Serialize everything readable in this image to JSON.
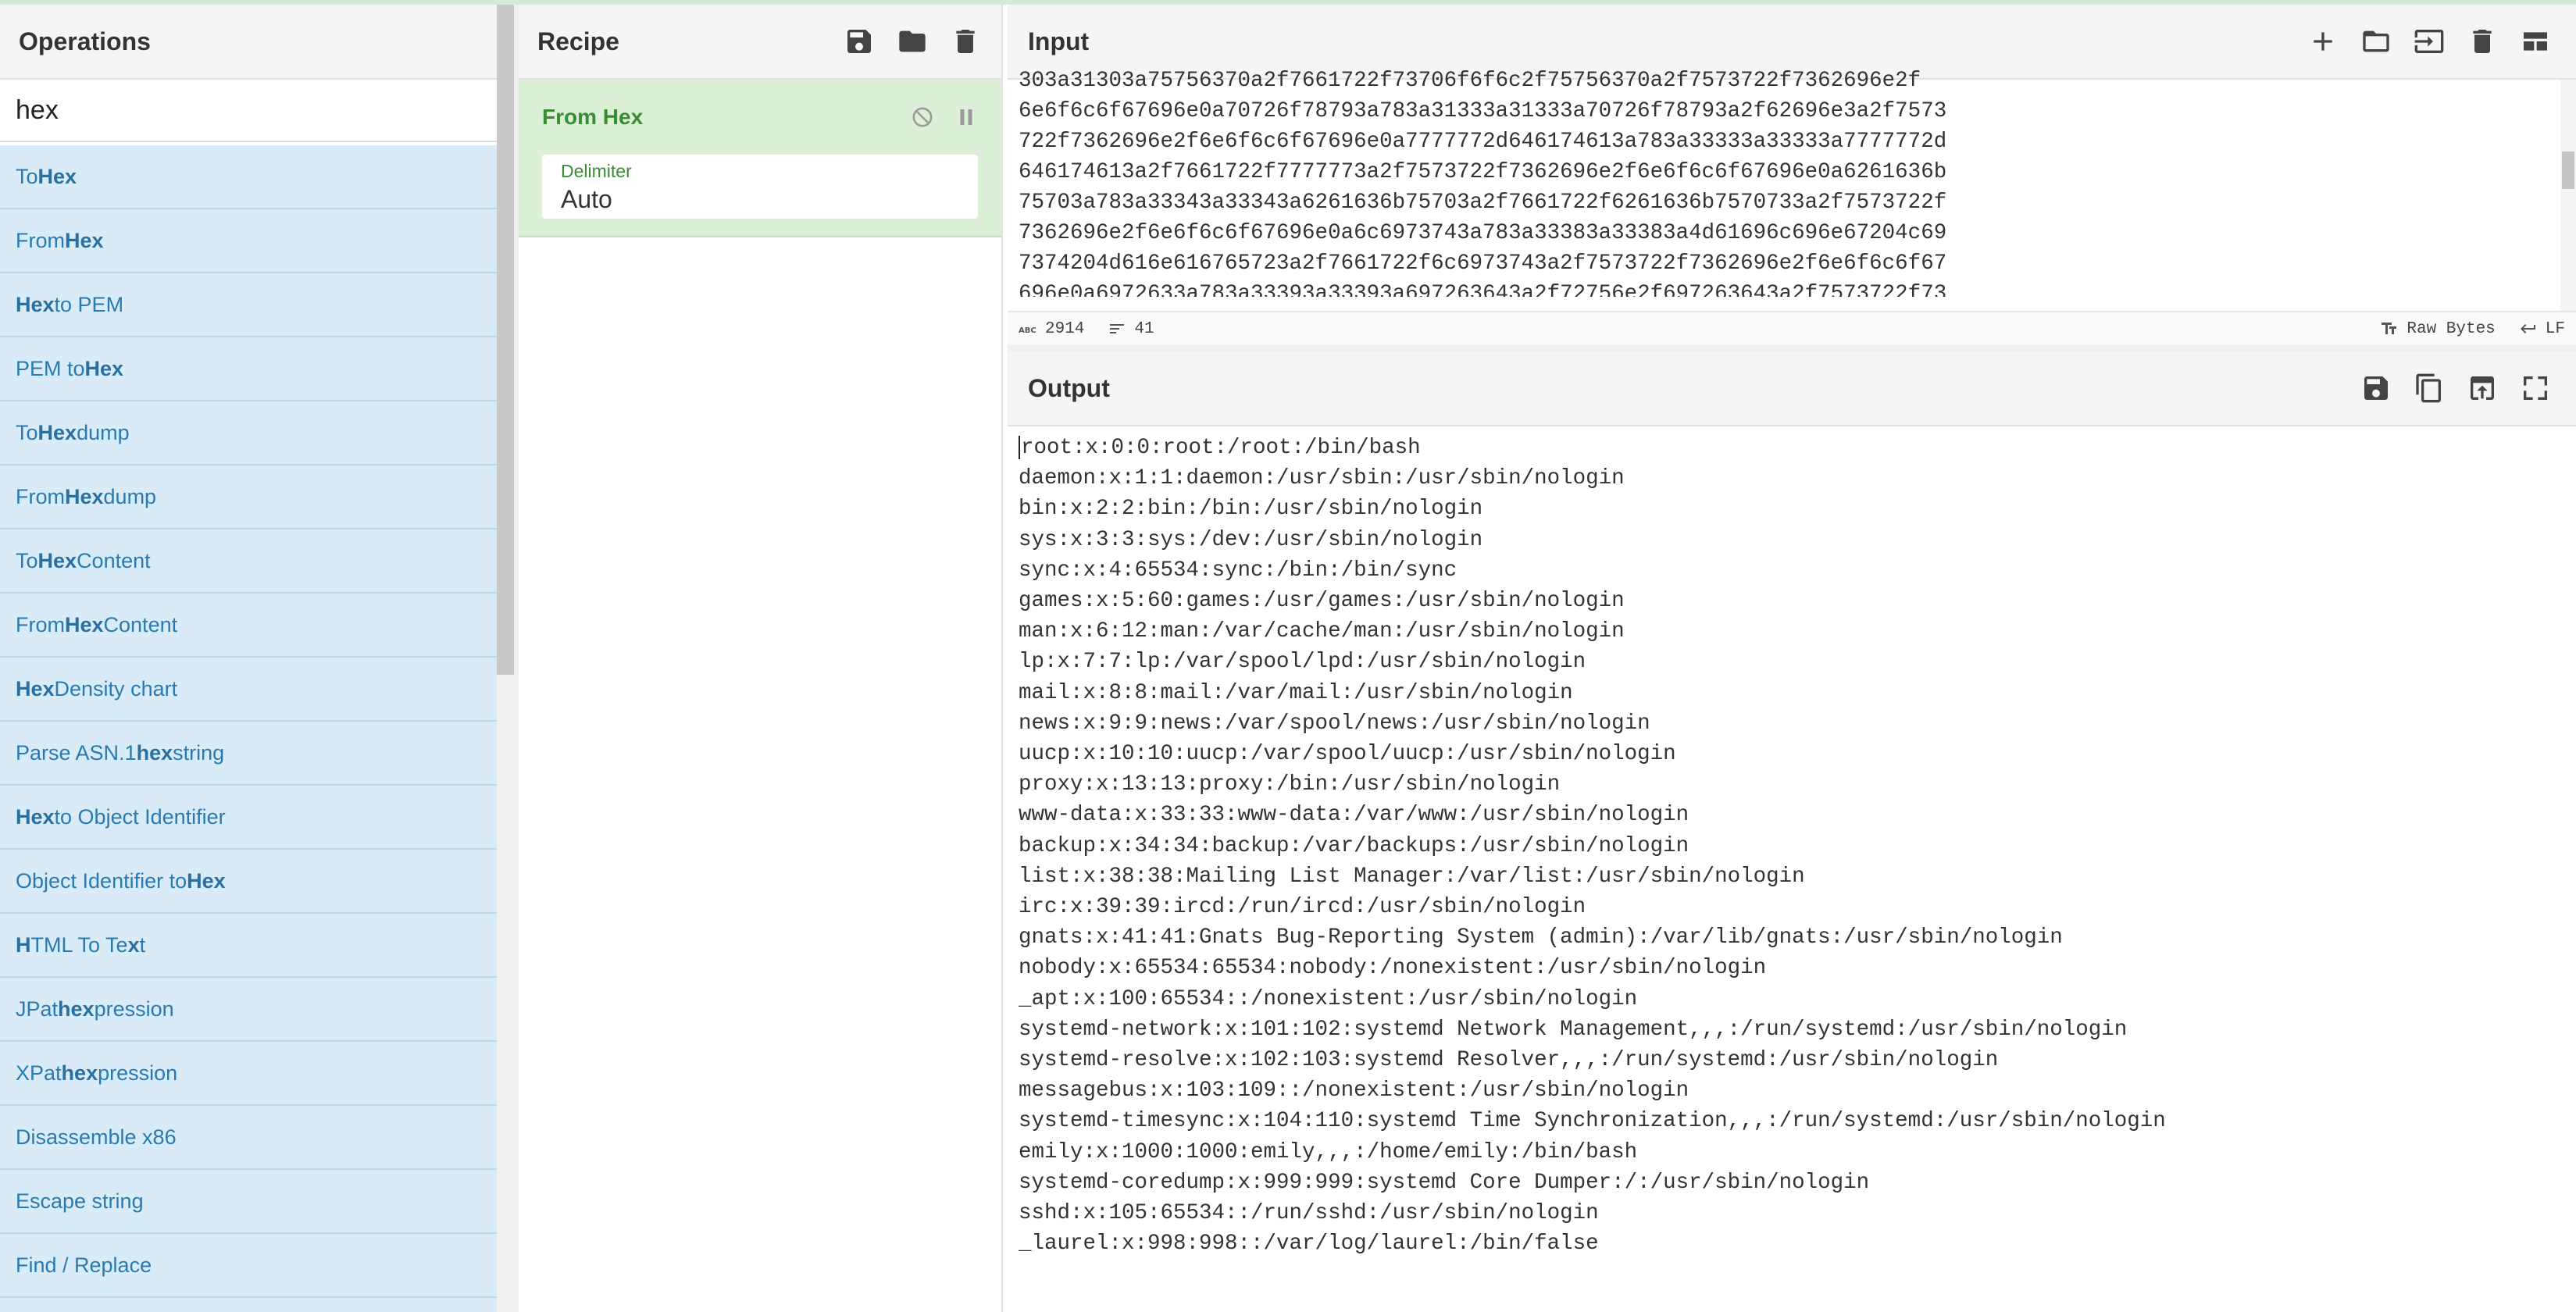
{
  "operations": {
    "title": "Operations",
    "search_value": "hex",
    "items": [
      {
        "pre": "To ",
        "bold": "Hex",
        "post": ""
      },
      {
        "pre": "From ",
        "bold": "Hex",
        "post": ""
      },
      {
        "pre": "",
        "bold": "Hex",
        "post": " to PEM"
      },
      {
        "pre": "PEM to ",
        "bold": "Hex",
        "post": ""
      },
      {
        "pre": "To ",
        "bold": "Hex",
        "post": "dump"
      },
      {
        "pre": "From ",
        "bold": "Hex",
        "post": "dump"
      },
      {
        "pre": "To ",
        "bold": "Hex",
        "post": " Content"
      },
      {
        "pre": "From ",
        "bold": "Hex",
        "post": " Content"
      },
      {
        "pre": "",
        "bold": "Hex",
        "post": " Density chart"
      },
      {
        "pre": "Parse ASN.1 ",
        "bold": "hex",
        "post": " string"
      },
      {
        "pre": "",
        "bold": "Hex",
        "post": " to Object Identifier"
      },
      {
        "pre": "Object Identifier to ",
        "bold": "Hex",
        "post": ""
      },
      {
        "pre": "",
        "bold": "H",
        "post": "TML To Te",
        "bold2": "x",
        "post2": "t"
      },
      {
        "pre": "JPat",
        "bold": "h",
        "post": " ",
        "bold2": "ex",
        "post2": "pression"
      },
      {
        "pre": "XPat",
        "bold": "h",
        "post": " ",
        "bold2": "ex",
        "post2": "pression"
      },
      {
        "pre": "Disassemble x86",
        "bold": "",
        "post": ""
      },
      {
        "pre": "Escape string",
        "bold": "",
        "post": ""
      },
      {
        "pre": "Find / Replace",
        "bold": "",
        "post": ""
      }
    ]
  },
  "recipe": {
    "title": "Recipe",
    "icons": [
      "save-icon",
      "folder-icon",
      "trash-icon"
    ],
    "operation": {
      "name": "From Hex",
      "icons": [
        "disable-icon",
        "pause-icon"
      ],
      "arg_label": "Delimiter",
      "arg_value": "Auto"
    }
  },
  "input": {
    "title": "Input",
    "icons": [
      "plus-icon",
      "folder-icon",
      "load-icon",
      "trash-icon",
      "layout-icon"
    ],
    "lines": [
      "303a31303a75756370a2f7661722f73706f6f6c2f75756370a2f7573722f7362696e2f",
      "6e6f6c6f67696e0a70726f78793a783a31333a31333a70726f78793a2f62696e3a2f7573",
      "722f7362696e2f6e6f6c6f67696e0a7777772d646174613a783a33333a33333a7777772d",
      "646174613a2f7661722f7777773a2f7573722f7362696e2f6e6f6c6f67696e0a6261636b",
      "75703a783a33343a33343a6261636b75703a2f7661722f6261636b7570733a2f7573722f",
      "7362696e2f6e6f6c6f67696e0a6c6973743a783a33383a33383a4d61696c696e67204c69",
      "7374204d616e616765723a2f7661722f6c6973743a2f7573722f7362696e2f6e6f6c6f67",
      "696e0a6972633a783a33393a33393a697263643a2f72756e2f697263643a2f7573722f73"
    ],
    "status": {
      "chars": "2914",
      "lines": "41",
      "encoding": "Raw Bytes",
      "eol": "LF"
    }
  },
  "output": {
    "title": "Output",
    "icons": [
      "save-icon",
      "copy-icon",
      "replace-input-icon",
      "maximise-icon"
    ],
    "lines": [
      "root:x:0:0:root:/root:/bin/bash",
      "daemon:x:1:1:daemon:/usr/sbin:/usr/sbin/nologin",
      "bin:x:2:2:bin:/bin:/usr/sbin/nologin",
      "sys:x:3:3:sys:/dev:/usr/sbin/nologin",
      "sync:x:4:65534:sync:/bin:/bin/sync",
      "games:x:5:60:games:/usr/games:/usr/sbin/nologin",
      "man:x:6:12:man:/var/cache/man:/usr/sbin/nologin",
      "lp:x:7:7:lp:/var/spool/lpd:/usr/sbin/nologin",
      "mail:x:8:8:mail:/var/mail:/usr/sbin/nologin",
      "news:x:9:9:news:/var/spool/news:/usr/sbin/nologin",
      "uucp:x:10:10:uucp:/var/spool/uucp:/usr/sbin/nologin",
      "proxy:x:13:13:proxy:/bin:/usr/sbin/nologin",
      "www-data:x:33:33:www-data:/var/www:/usr/sbin/nologin",
      "backup:x:34:34:backup:/var/backups:/usr/sbin/nologin",
      "list:x:38:38:Mailing List Manager:/var/list:/usr/sbin/nologin",
      "irc:x:39:39:ircd:/run/ircd:/usr/sbin/nologin",
      "gnats:x:41:41:Gnats Bug-Reporting System (admin):/var/lib/gnats:/usr/sbin/nologin",
      "nobody:x:65534:65534:nobody:/nonexistent:/usr/sbin/nologin",
      "_apt:x:100:65534::/nonexistent:/usr/sbin/nologin",
      "systemd-network:x:101:102:systemd Network Management,,,:/run/systemd:/usr/sbin/nologin",
      "systemd-resolve:x:102:103:systemd Resolver,,,:/run/systemd:/usr/sbin/nologin",
      "messagebus:x:103:109::/nonexistent:/usr/sbin/nologin",
      "systemd-timesync:x:104:110:systemd Time Synchronization,,,:/run/systemd:/usr/sbin/nologin",
      "emily:x:1000:1000:emily,,,:/home/emily:/bin/bash",
      "systemd-coredump:x:999:999:systemd Core Dumper:/:/usr/sbin/nologin",
      "sshd:x:105:65534::/run/sshd:/usr/sbin/nologin",
      "_laurel:x:998:998::/var/log/laurel:/bin/false"
    ]
  }
}
